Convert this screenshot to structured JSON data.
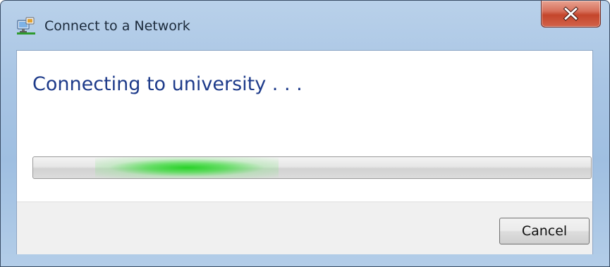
{
  "window": {
    "title": "Connect to a Network",
    "icon": "network-connection-icon",
    "close_icon": "close-icon"
  },
  "main": {
    "heading": "Connecting to university . . .",
    "progress": {
      "style": "marquee",
      "indeterminate": true,
      "color": "#2fd22f"
    }
  },
  "footer": {
    "cancel_label": "Cancel"
  },
  "colors": {
    "heading": "#1e3b8a",
    "titlebar": "#b9d1ea",
    "close_button": "#c4452b"
  }
}
